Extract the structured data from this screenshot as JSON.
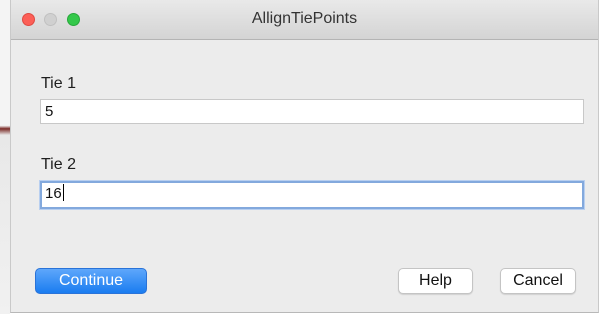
{
  "window": {
    "title": "AllignTiePoints"
  },
  "fields": [
    {
      "label": "Tie 1",
      "value": "5",
      "focused": false
    },
    {
      "label": "Tie 2",
      "value": "16",
      "focused": true
    }
  ],
  "buttons": {
    "continue_label": "Continue",
    "help_label": "Help",
    "cancel_label": "Cancel"
  },
  "colors": {
    "primary_button": "#1a7cf0",
    "close_light": "#fc5f57",
    "zoom_light": "#34c84a",
    "focus_ring": "#83a9dd"
  },
  "icons": {
    "close": "close-window-icon",
    "minimize": "minimize-window-icon",
    "zoom": "zoom-window-icon"
  }
}
